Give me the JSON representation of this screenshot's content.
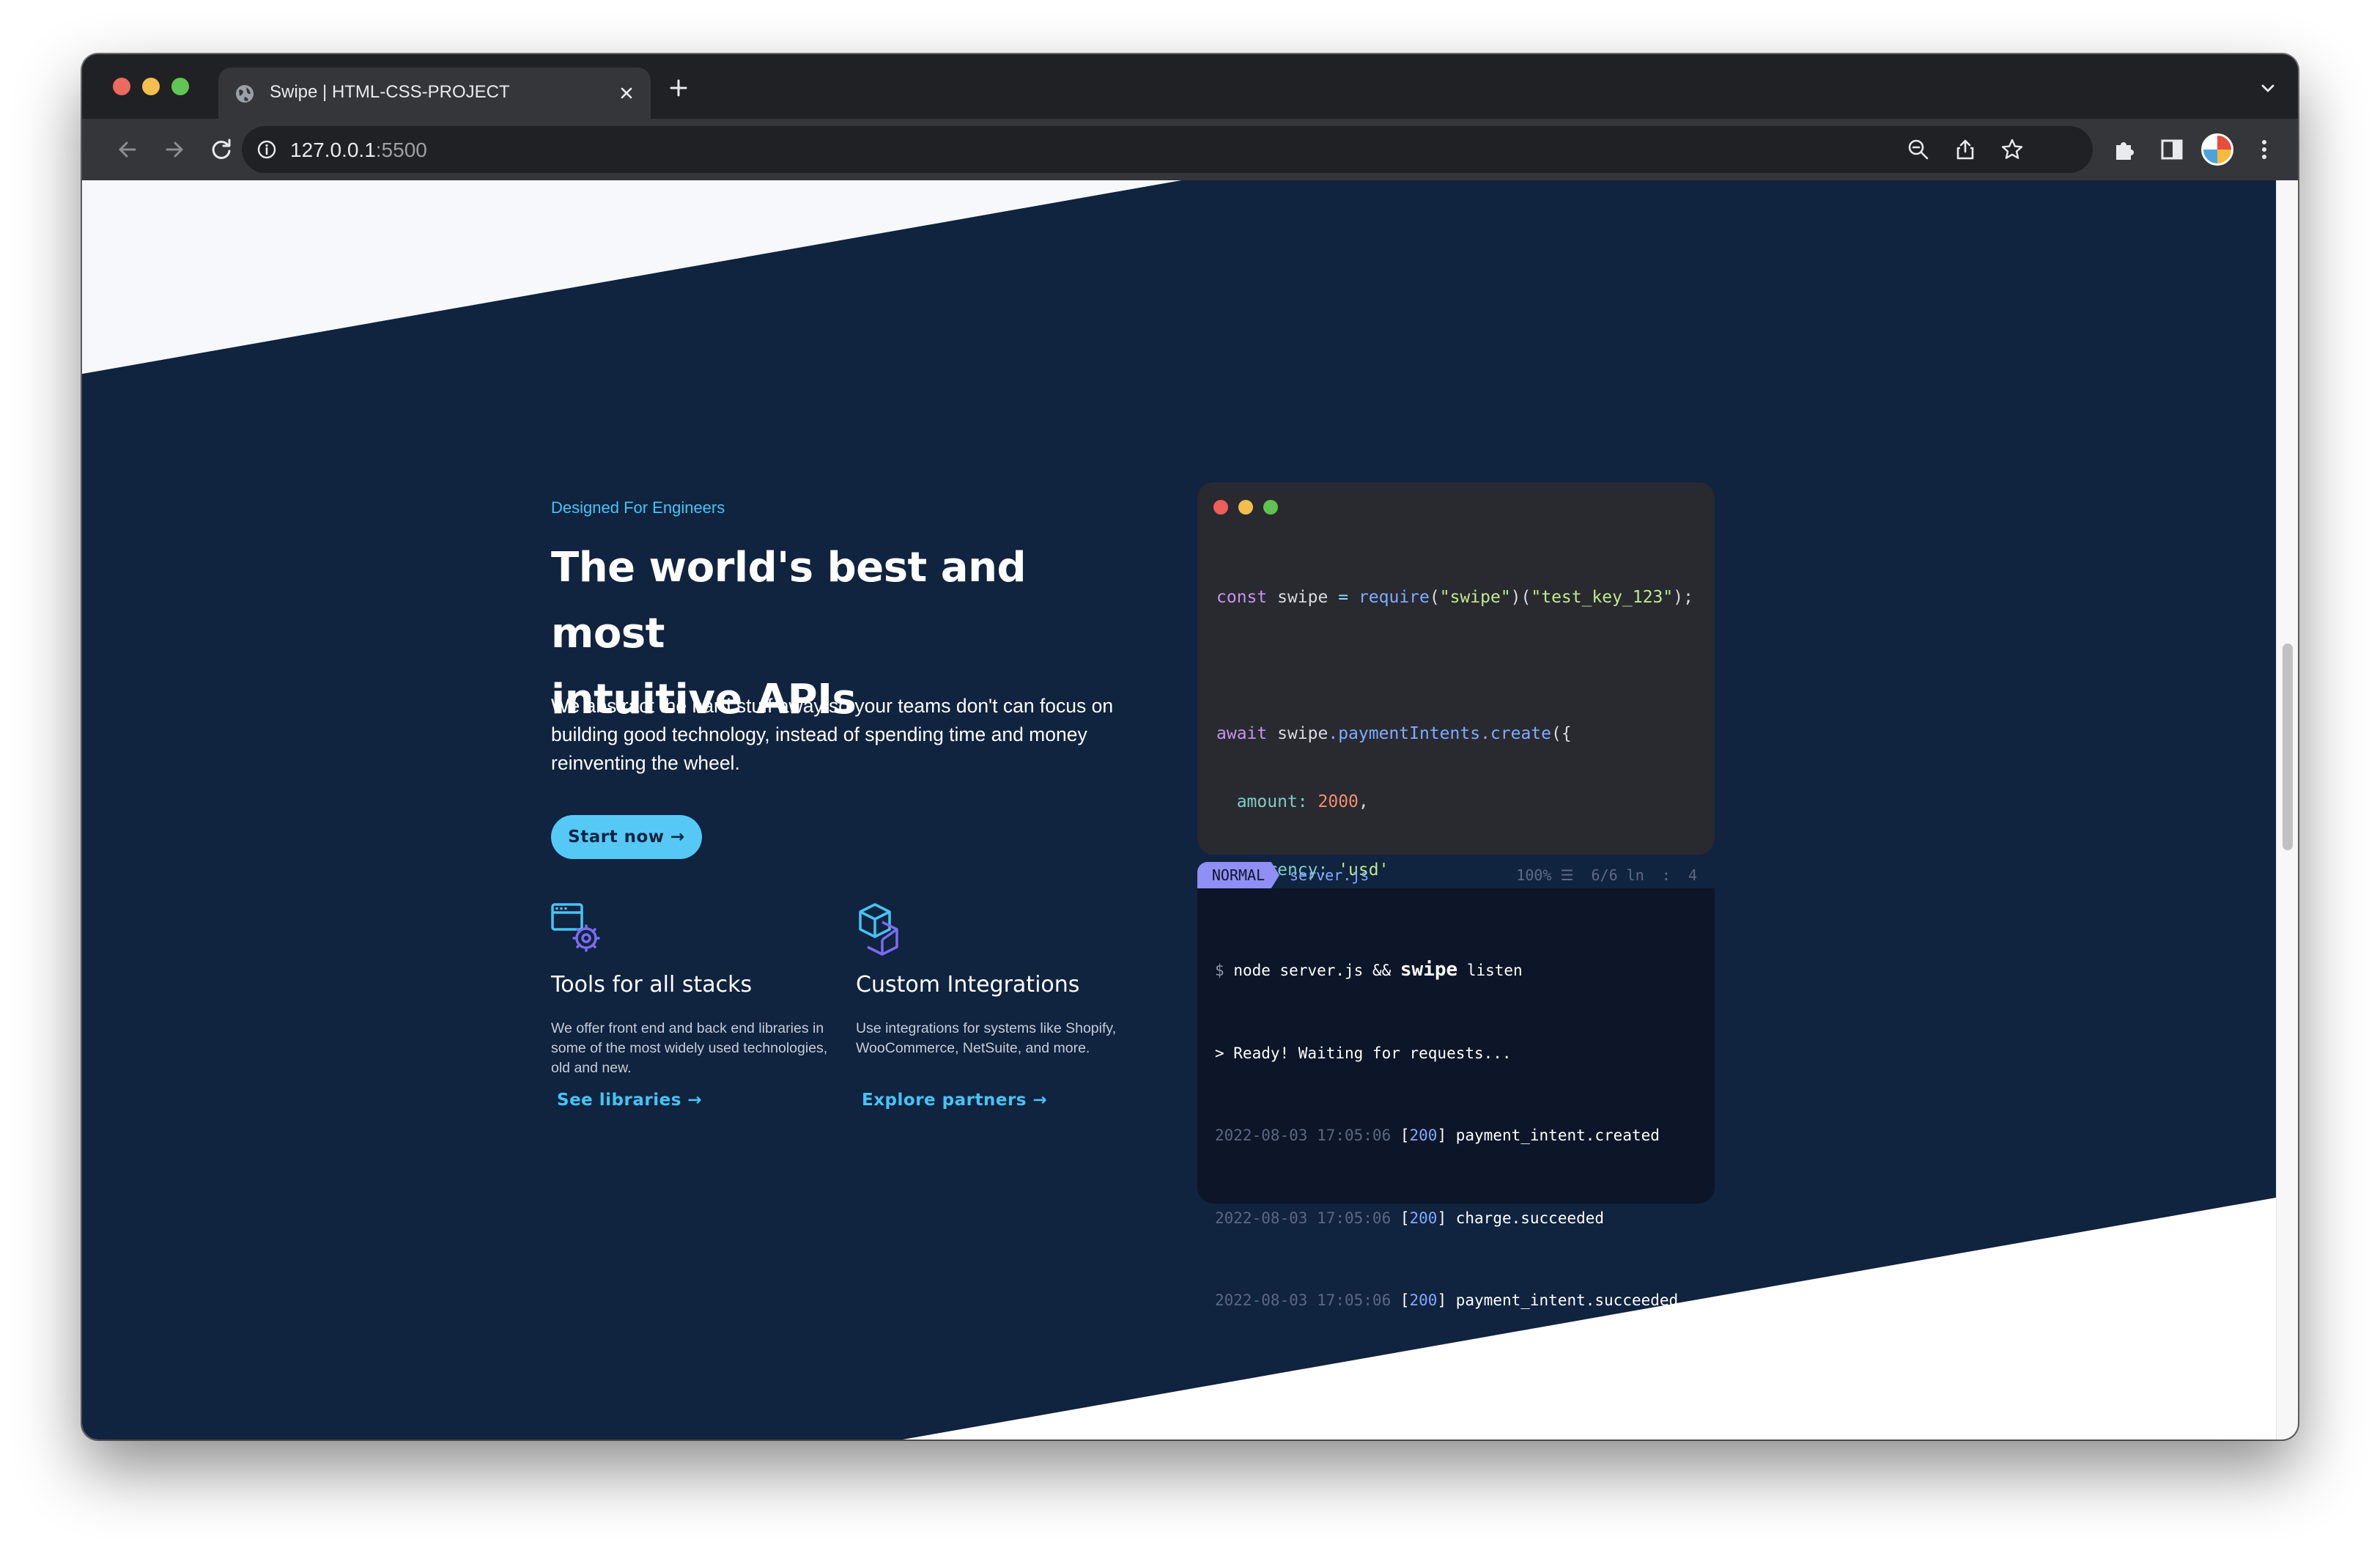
{
  "browser": {
    "tab_title": "Swipe | HTML-CSS-PROJECT",
    "url_host": "127.0.0.1",
    "url_port": ":5500"
  },
  "section": {
    "eyebrow": "Designed For Engineers",
    "headline_line1": "The world's best and most",
    "headline_line2": "intuitive APIs",
    "lead": "We abstract the hard stuff away so your teams don't can focus on building good technology, instead of spending time and money reinventing the wheel.",
    "cta_label": "Start now →"
  },
  "features": [
    {
      "title": "Tools for all stacks",
      "description": "We offer front end and back end libraries in some of the most widely used technologies, old and new.",
      "link_label": "See libraries →",
      "icon": "browser-gear-icon"
    },
    {
      "title": "Custom Integrations",
      "description": "Use integrations for systems like Shopify, WooCommerce, NetSuite, and more.",
      "link_label": "Explore partners →",
      "icon": "cube-icon"
    }
  ],
  "editor": {
    "line1": {
      "kw": "const",
      "var": "swipe",
      "eq": "=",
      "fn": "require",
      "arg1": "\"swipe\"",
      "arg2": "\"test_key_123\"",
      "end": ");"
    },
    "line2": {
      "kw": "await",
      "obj": "swipe",
      "method": ".paymentIntents.create",
      "open": "({"
    },
    "line3": {
      "key": "amount:",
      "value": "2000",
      "end": ","
    },
    "line4": {
      "key": "currency:",
      "value": "'usd'"
    },
    "line5": "});"
  },
  "status": {
    "mode": "NORMAL",
    "file": "server.js",
    "right": "100% ☰  6/6 ln  :  4"
  },
  "terminal": {
    "cmd_prompt": "$",
    "cmd_text": "node server.js &&",
    "cmd_strong": "swipe",
    "cmd_tail": "listen",
    "ready": "> Ready! Waiting for requests...",
    "logs": [
      {
        "ts": "2022-08-03 17:05:06",
        "code": "200",
        "event": "payment_intent.created"
      },
      {
        "ts": "2022-08-03 17:05:06",
        "code": "200",
        "event": "charge.succeeded"
      },
      {
        "ts": "2022-08-03 17:05:06",
        "code": "200",
        "event": "payment_intent.succeeded"
      }
    ]
  },
  "colors": {
    "navy": "#10233f",
    "accent": "#55c8f6",
    "editor_bg": "#282a30",
    "terminal_bg": "#0c1628"
  }
}
